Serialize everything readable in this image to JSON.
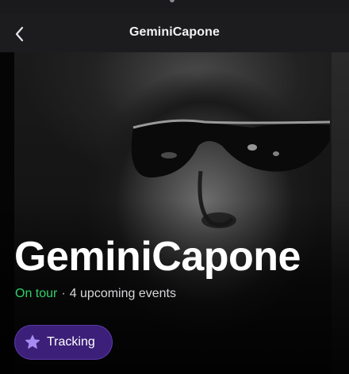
{
  "header": {
    "title": "GeminiCapone",
    "back_icon": "chevron-left-icon"
  },
  "artist": {
    "name": "GeminiCapone",
    "tour_status": "On tour",
    "separator": "·",
    "upcoming_events": "4 upcoming events"
  },
  "actions": {
    "tracking_label": "Tracking",
    "tracking_icon": "star-icon"
  },
  "colors": {
    "on_tour": "#2fd26a",
    "tracking_button_bg": "#3b1f78",
    "tracking_icon": "#a68cf2",
    "navbar_bg": "#1c1c1f"
  }
}
